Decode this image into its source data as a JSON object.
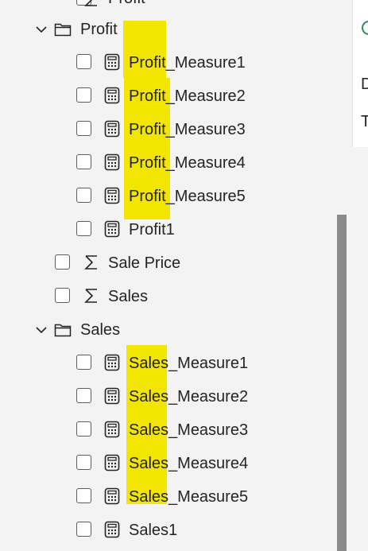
{
  "top_partial": {
    "label": "Profit"
  },
  "groups": [
    {
      "folder": "Profit",
      "items": [
        {
          "label": "Profit_Measure1",
          "icon": "calculator-icon",
          "highlight": "Profit"
        },
        {
          "label": "Profit_Measure2",
          "icon": "calculator-icon",
          "highlight": "Profit"
        },
        {
          "label": "Profit_Measure3",
          "icon": "calculator-icon",
          "highlight": "Profit"
        },
        {
          "label": "Profit_Measure4",
          "icon": "calculator-icon",
          "highlight": "Profit"
        },
        {
          "label": "Profit_Measure5",
          "icon": "calculator-icon",
          "highlight": "Profit"
        },
        {
          "label": "Profit1",
          "icon": "calculator-icon"
        }
      ]
    },
    {
      "folder": "Sales",
      "items": [
        {
          "label": "Sales_Measure1",
          "icon": "calculator-icon",
          "highlight": "Sales"
        },
        {
          "label": "Sales_Measure2",
          "icon": "calculator-icon",
          "highlight": "Sales"
        },
        {
          "label": "Sales_Measure3",
          "icon": "calculator-icon",
          "highlight": "Sales"
        },
        {
          "label": "Sales_Measure4",
          "icon": "calculator-icon",
          "highlight": "Sales"
        },
        {
          "label": "Sales_Measure5",
          "icon": "calculator-icon",
          "highlight": "Sales"
        },
        {
          "label": "Sales1",
          "icon": "calculator-icon"
        }
      ]
    }
  ],
  "fields": [
    {
      "label": "Sale Price",
      "icon": "sigma-icon"
    },
    {
      "label": "Sales",
      "icon": "sigma-icon"
    }
  ],
  "right_pane": {
    "letter_1": "D",
    "letter_2": "T"
  },
  "colors": {
    "highlight": "#f2e600",
    "background": "#f3f3f3",
    "scrollbar": "#8a8a8a"
  }
}
